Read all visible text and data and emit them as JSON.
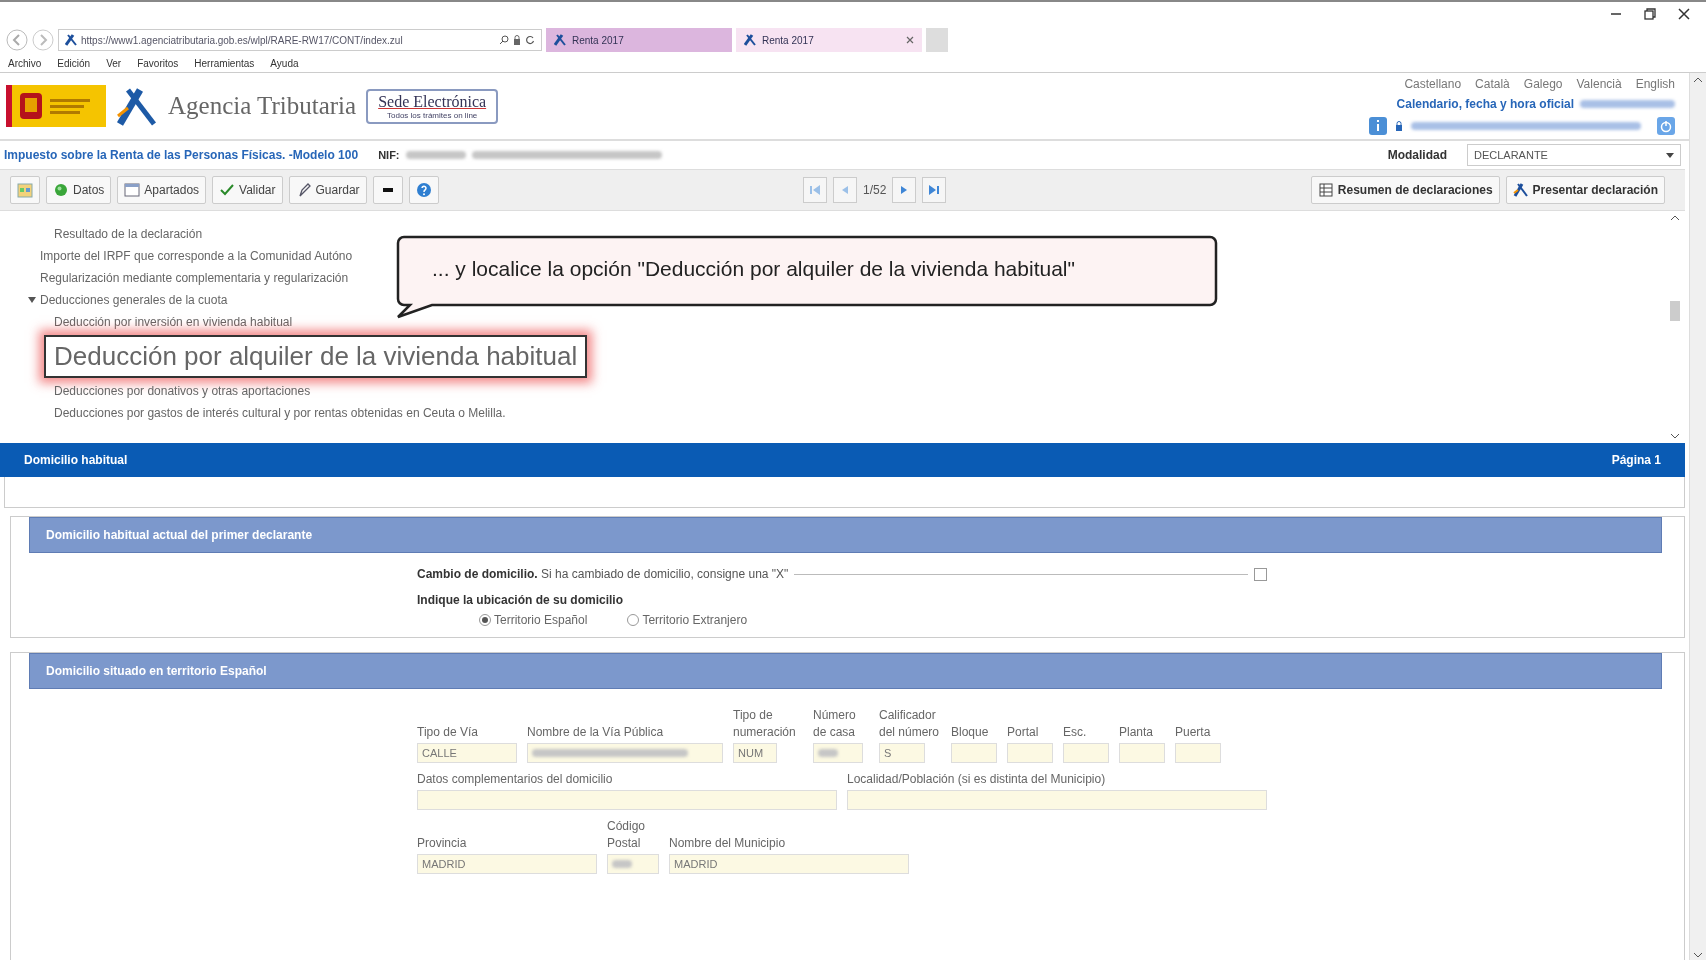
{
  "browser": {
    "url": "https://www1.agenciatributaria.gob.es/wlpl/RARE-RW17/CONT/index.zul",
    "tabs": [
      {
        "label": "Renta 2017",
        "selected": false
      },
      {
        "label": "Renta 2017",
        "selected": true
      }
    ],
    "menu": [
      "Archivo",
      "Edición",
      "Ver",
      "Favoritos",
      "Herramientas",
      "Ayuda"
    ]
  },
  "header": {
    "agency": "Agencia Tributaria",
    "sede_title": "Sede Electrónica",
    "sede_subtitle": "Todos los trámites on line",
    "languages": [
      "Castellano",
      "Català",
      "Galego",
      "Valencià",
      "English"
    ],
    "calendar_label": "Calendario, fecha y hora oficial"
  },
  "model_title": "Impuesto sobre la Renta de las Personas Físicas. -Modelo 100",
  "nif_label": "NIF:",
  "modalidad": {
    "label": "Modalidad",
    "value": "DECLARANTE"
  },
  "toolbar": {
    "buttons": [
      {
        "kind": "calendar"
      },
      {
        "kind": "datos",
        "label": "Datos"
      },
      {
        "kind": "apartados",
        "label": "Apartados"
      },
      {
        "kind": "validar",
        "label": "Validar"
      },
      {
        "kind": "guardar",
        "label": "Guardar"
      },
      {
        "kind": "minus"
      },
      {
        "kind": "help"
      }
    ],
    "pager": "1/52",
    "right_buttons": [
      {
        "kind": "resumen",
        "label": "Resumen de declaraciones"
      },
      {
        "kind": "presentar",
        "label": "Presentar declaración"
      }
    ]
  },
  "tree": [
    {
      "children": [
        {
          "label": "Resultado de la declaración"
        }
      ]
    },
    {
      "label": "Importe del IRPF que corresponde a la Comunidad Autóno"
    },
    {
      "label": "Regularización mediante complementaria y regularización"
    },
    {
      "label": "Deducciones generales de la cuota",
      "expanded": true,
      "children": [
        {
          "label": "Deducción por inversión en vivienda habitual",
          "highlighted": false
        },
        {
          "label": "Deducción por alquiler de la vivienda habitual",
          "highlighted": true
        },
        {
          "label": "Deducciones por donativos y otras aportaciones",
          "highlighted": false
        },
        {
          "label": "Deducciones por gastos de interés cultural y por rentas obtenidas en Ceuta o Melilla.",
          "highlighted": false
        }
      ]
    }
  ],
  "callout": "... y localice la opción \"Deducción por alquiler de la vivienda habitual\"",
  "page_bar": {
    "title": "Domicilio habitual",
    "page": "Página 1"
  },
  "section1": {
    "title": "Domicilio habitual actual del primer declarante",
    "change": {
      "text": "**Cambio de domicilio.** Si ha cambiado de domicilio, consigne una \"X\"",
      "checked": false
    },
    "location": {
      "label": "Indique la ubicación de su domicilio",
      "options": [
        {
          "label": "Territorio Español",
          "selected": true
        },
        {
          "label": "Territorio Extranjero",
          "selected": false
        }
      ]
    }
  },
  "section2": {
    "title": "Domicilio situado en territorio Español",
    "lines": {
      "street": [
        {
          "label": "Tipo de Vía",
          "value": "CALLE"
        },
        {
          "label": "Nombre de la Vía Pública",
          "redacted": true
        },
        {
          "label": "Tipo de numeración",
          "value": "NUM"
        },
        {
          "label": "Número de casa",
          "redacted": true
        },
        {
          "label": "Calificador del número",
          "value": "S"
        },
        {
          "label": "Bloque"
        },
        {
          "label": "Portal"
        },
        {
          "label": "Esc."
        },
        {
          "label": "Planta"
        },
        {
          "label": "Puerta"
        }
      ],
      "complement": [
        {
          "label": "Datos complementarios del domicilio"
        },
        {
          "label": "Localidad/Población (si es distinta del Municipio)"
        }
      ],
      "town": [
        {
          "label": "Provincia",
          "value": "MADRID"
        },
        {
          "label": "Código Postal",
          "redacted": true
        },
        {
          "label": "Nombre del Municipio",
          "value": "MADRID"
        }
      ]
    }
  }
}
